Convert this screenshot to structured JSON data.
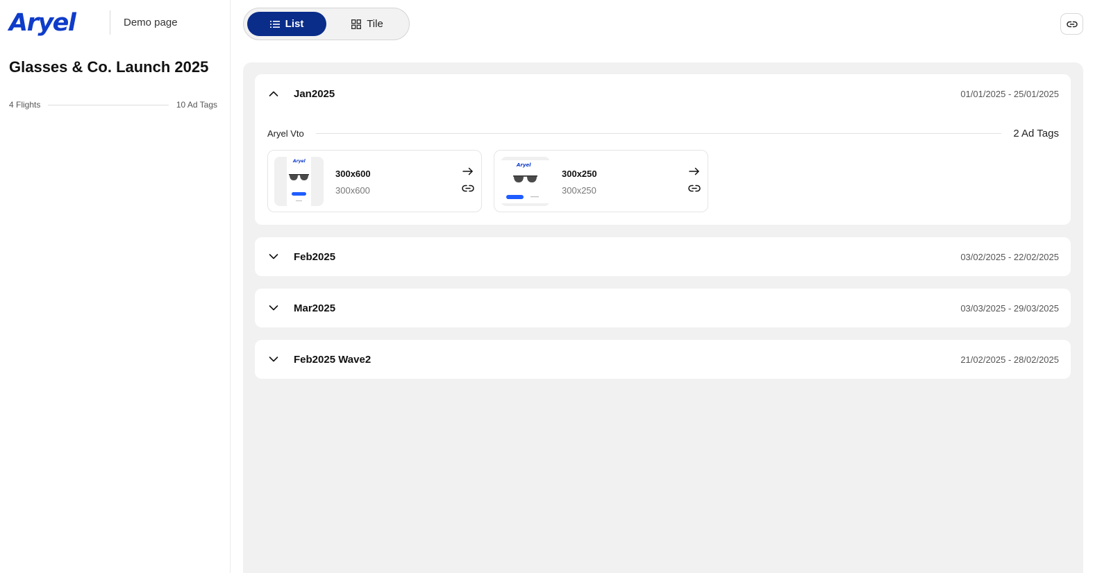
{
  "brand": {
    "logo": "Aryel",
    "subtitle": "Demo page",
    "color": "#0f3cc9"
  },
  "campaign": {
    "title": "Glasses & Co. Launch 2025",
    "flights": "4 Flights",
    "ad_tags": "10 Ad Tags"
  },
  "view_toggle": {
    "list": {
      "label": "List",
      "icon": "list-icon",
      "active": true
    },
    "tile": {
      "label": "Tile",
      "icon": "grid-icon",
      "active": false
    }
  },
  "share": {
    "icon": "link-icon"
  },
  "flights": [
    {
      "name": "Jan2025",
      "dates": "01/01/2025 - 25/01/2025",
      "expanded": true,
      "groups": [
        {
          "name": "Aryel Vto",
          "count": "2 Ad Tags",
          "ads": [
            {
              "title": "300x600",
              "subtitle": "300x600",
              "thumb_logo": "Aryel"
            },
            {
              "title": "300x250",
              "subtitle": "300x250",
              "thumb_logo": "Aryel"
            }
          ]
        }
      ]
    },
    {
      "name": "Feb2025",
      "dates": "03/02/2025 - 22/02/2025",
      "expanded": false
    },
    {
      "name": "Mar2025",
      "dates": "03/03/2025 - 29/03/2025",
      "expanded": false
    },
    {
      "name": "Feb2025 Wave2",
      "dates": "21/02/2025 - 28/02/2025",
      "expanded": false
    }
  ],
  "colors": {
    "accent": "#0a2d8a",
    "cta": "#1f5cff",
    "panel": "#f1f1f1"
  }
}
